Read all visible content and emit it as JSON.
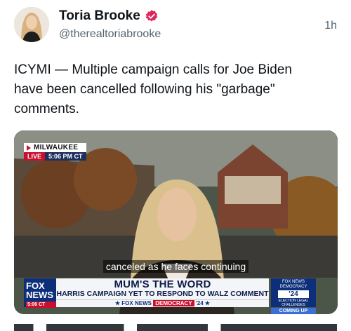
{
  "post": {
    "display_name": "Toria Brooke",
    "handle": "@therealtoriabrooke",
    "timestamp": "1h",
    "verified_icon": "verified-badge-icon",
    "text": "ICYMI — Multiple campaign calls for Joe Biden have been cancelled following his \"garbage\" comments."
  },
  "video": {
    "location": "MILWAUKEE",
    "live": "LIVE",
    "live_time": "5:06 PM CT",
    "caption": "canceled as he faces continuing",
    "network_logo_line1": "FOX",
    "network_logo_line2": "NEWS",
    "network_logo_time": "5:06 CT",
    "headline": "MUM'S THE WORD",
    "subheadline": "HARRIS CAMPAIGN YET TO RESPOND TO WALZ COMMENT",
    "ticker_brand": "FOX NEWS",
    "ticker_democracy": "DEMOCRACY",
    "ticker_year": "'24",
    "side_top": "FOX NEWS DEMOCRACY",
    "side_year": "'24",
    "side_mid": "ELECTION LEGAL CHALLENGES",
    "side_bottom": "COMING UP",
    "accent_red": "#c8102e",
    "accent_blue": "#0d2f7a"
  }
}
